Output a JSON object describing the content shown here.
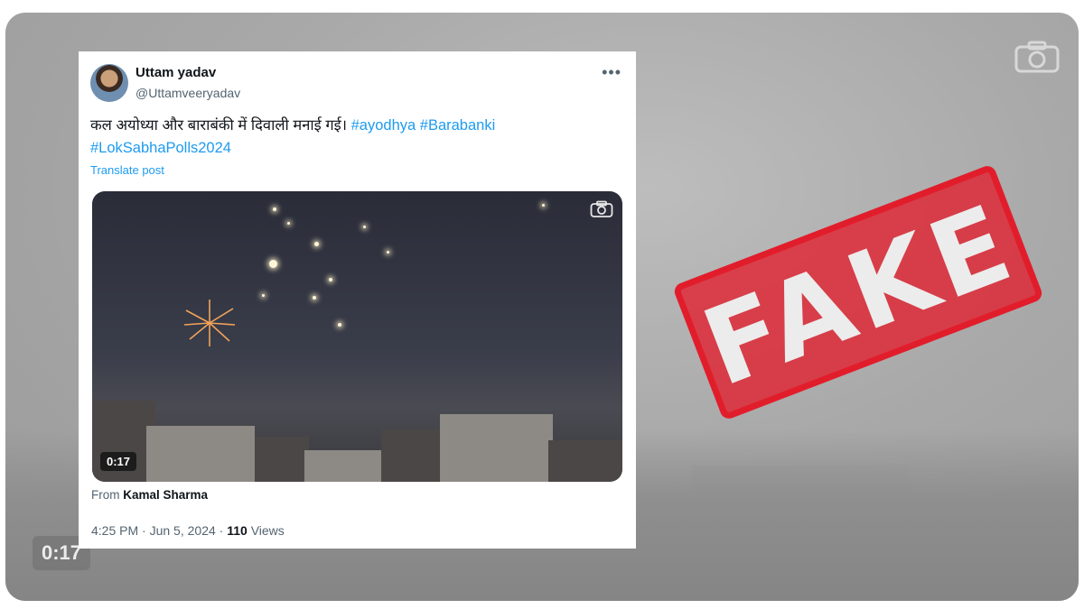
{
  "background": {
    "timestamp": "0:17",
    "camera_icon": "camera-icon"
  },
  "tweet": {
    "display_name": "Uttam yadav",
    "handle": "@Uttamveeryadav",
    "more_icon": "more-icon",
    "text_main": "कल अयोध्या और बाराबंकी में दिवाली मनाई गई। ",
    "hashtags": [
      "#ayodhya",
      "#Barabanki",
      "#LokSabhaPolls2024"
    ],
    "translate_label": "Translate post",
    "video": {
      "duration": "0:17",
      "camera_icon": "camera-icon"
    },
    "from_prefix": "From ",
    "from_name": "Kamal Sharma",
    "time": "4:25 PM",
    "date": "Jun 5, 2024",
    "views_count": "110",
    "views_label": " Views"
  },
  "stamp": {
    "text": "FAKE",
    "color": "#e21d2b"
  },
  "colors": {
    "link": "#1d9bf0",
    "text": "#0f1419",
    "muted": "#536471"
  }
}
